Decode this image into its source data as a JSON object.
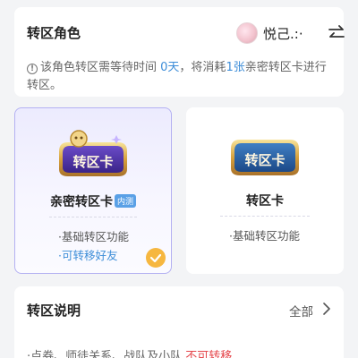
{
  "header": {
    "title": "转区角色",
    "username": "悦己.:·"
  },
  "notice": {
    "prefix": "该角色转区需等待时间 ",
    "days": "0天",
    "middle": "，将消耗",
    "count": "1张",
    "suffix": "亲密转区卡进行转区。"
  },
  "cards": {
    "intimate": {
      "badge_text": "转区卡",
      "name": "亲密转区卡",
      "tag": "内测",
      "features": [
        "·基础转区功能",
        "·可转移好友"
      ],
      "selected": true
    },
    "normal": {
      "badge_text": "转区卡",
      "name": "转区卡",
      "features": [
        "·基础转区功能"
      ],
      "selected": false
    }
  },
  "explain": {
    "title": "转区说明",
    "view_all": "全部",
    "rule_prefix": "·点券、师徒关系、战队及小队 ",
    "rule_red": "不可转移"
  },
  "colors": {
    "accent_blue": "#3d8dd8",
    "selected_border": "#b4b1f2",
    "check_orange": "#f6b740",
    "warning_red": "#e5484d"
  }
}
